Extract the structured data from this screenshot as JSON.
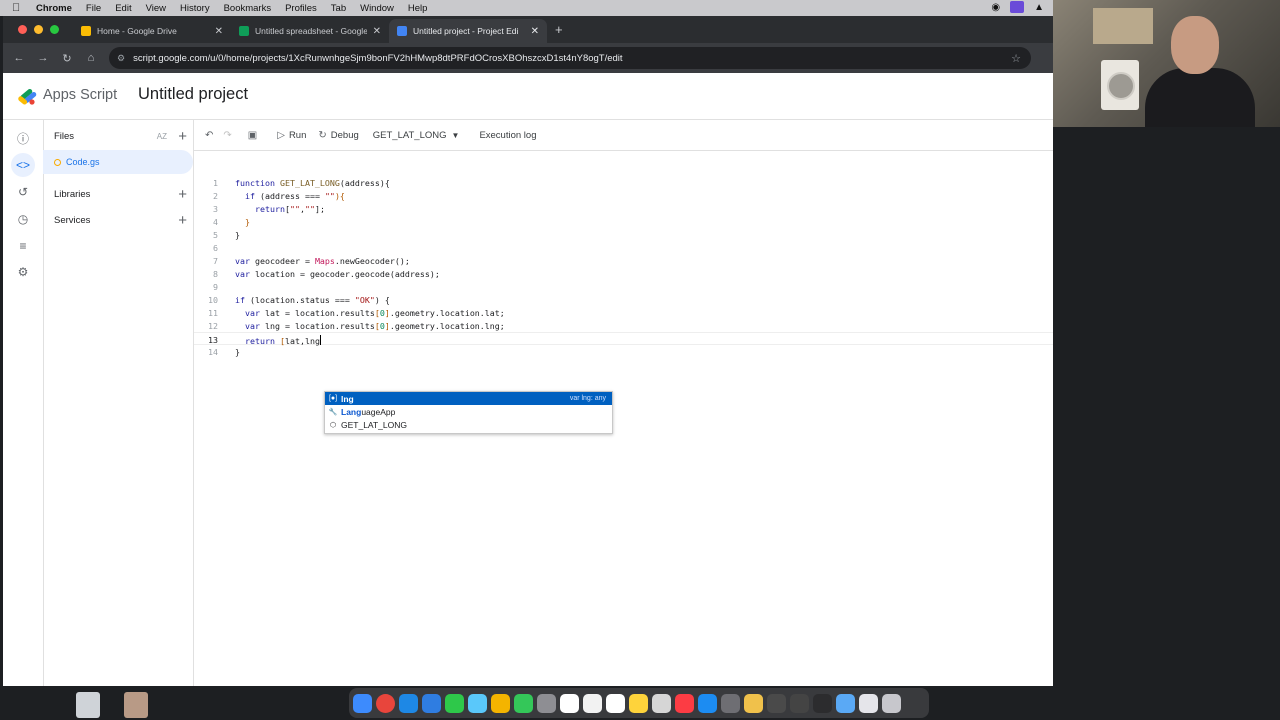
{
  "menubar": {
    "app": "Chrome",
    "items": [
      "File",
      "Edit",
      "View",
      "History",
      "Bookmarks",
      "Profiles",
      "Tab",
      "Window",
      "Help"
    ]
  },
  "browser": {
    "tabs": [
      {
        "title": "Home - Google Drive",
        "favicon_color": "#fbbc04"
      },
      {
        "title": "Untitled spreadsheet - Google",
        "favicon_color": "#0f9d58"
      },
      {
        "title": "Untitled project - Project Edi",
        "favicon_color": "#4285f4"
      }
    ],
    "url": "script.google.com/u/0/home/projects/1XcRunwnhgeSjm9bonFV2hHMwp8dtPRFdOCrosXBOhszcxD1st4nY8ogT/edit"
  },
  "header": {
    "app_name": "Apps Script",
    "project_name": "Untitled project"
  },
  "files_panel": {
    "files_label": "Files",
    "sort_label": "AZ",
    "file_name": "Code.gs",
    "libraries_label": "Libraries",
    "services_label": "Services"
  },
  "toolbar": {
    "run_label": "Run",
    "debug_label": "Debug",
    "function_select": "GET_LAT_LONG",
    "execution_log_label": "Execution log"
  },
  "editor": {
    "line_numbers": [
      "1",
      "2",
      "3",
      "4",
      "5",
      "6",
      "7",
      "8",
      "9",
      "10",
      "11",
      "12",
      "13",
      "14"
    ],
    "current_line": "13"
  },
  "autocomplete": {
    "items": [
      {
        "match": "lng",
        "rest": "",
        "detail": "var lng: any",
        "icon": "variable-icon"
      },
      {
        "match": "Lang",
        "rest": "uageApp",
        "detail": "",
        "icon": "wrench-icon"
      },
      {
        "match": "",
        "rest": "GET_LAT_LONG",
        "detail": "",
        "icon": "function-icon"
      }
    ]
  }
}
